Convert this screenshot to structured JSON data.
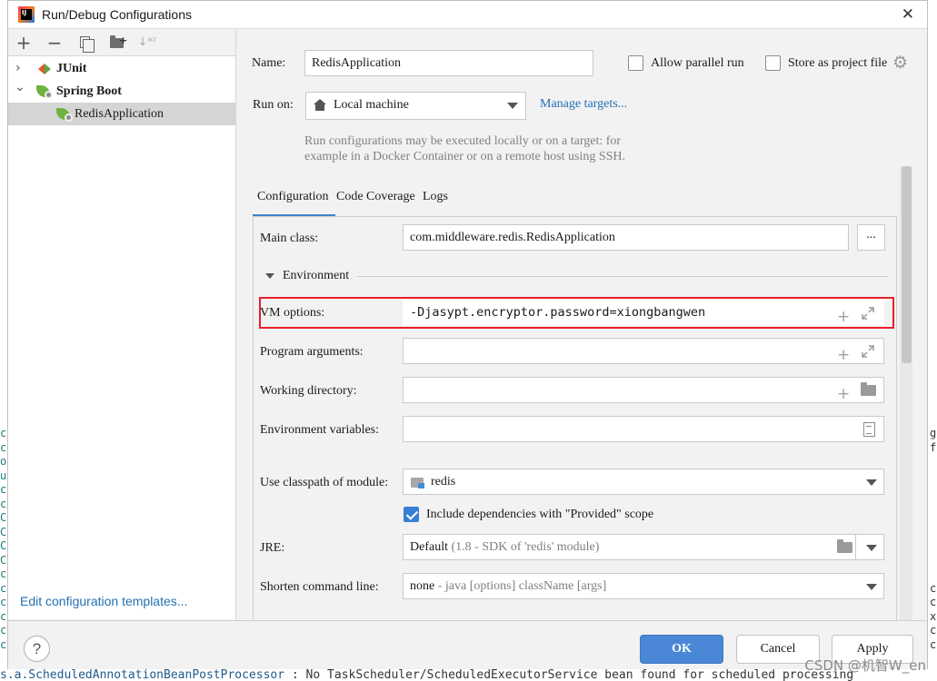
{
  "dialog": {
    "title": "Run/Debug Configurations"
  },
  "toolbar": {
    "add": "+",
    "remove": "−",
    "sort": "↓ᵃᶻ"
  },
  "tree": {
    "items": [
      {
        "label": "JUnit",
        "chevron": "›"
      },
      {
        "label": "Spring Boot",
        "chevron": "⌄"
      },
      {
        "label": "RedisApplication"
      }
    ]
  },
  "left_panel": {
    "edit_templates": "Edit configuration templates..."
  },
  "form": {
    "name_label": "Name:",
    "name_value": "RedisApplication",
    "allow_parallel_label": "Allow parallel run",
    "allow_parallel_checked": false,
    "store_project_label": "Store as project file",
    "store_project_checked": false,
    "run_on_label": "Run on:",
    "run_on_value": "Local machine",
    "manage_targets": "Manage targets...",
    "hint_line1": "Run configurations may be executed locally or on a target: for",
    "hint_line2": "example in a Docker Container or on a remote host using SSH."
  },
  "tabs": [
    {
      "label": "Configuration",
      "active": true
    },
    {
      "label": "Code Coverage",
      "active": false
    },
    {
      "label": "Logs",
      "active": false
    }
  ],
  "config": {
    "main_class_label": "Main class:",
    "main_class_value": "com.middleware.redis.RedisApplication",
    "browse_button": "...",
    "environment_label": "Environment",
    "vm_options_label": "VM options:",
    "vm_options_value": "-Djasypt.encryptor.password=xiongbangwen",
    "program_args_label": "Program arguments:",
    "program_args_value": "",
    "working_dir_label": "Working directory:",
    "working_dir_value": "",
    "env_vars_label": "Environment variables:",
    "env_vars_value": "",
    "classpath_label": "Use classpath of module:",
    "classpath_value": "redis",
    "include_deps_label": "Include dependencies with \"Provided\" scope",
    "include_deps_checked": true,
    "jre_label": "JRE:",
    "jre_value": "Default",
    "jre_detail": "(1.8 - SDK of 'redis' module)",
    "shorten_label": "Shorten command line:",
    "shorten_value": "none",
    "shorten_detail": "- java [options] className [args]"
  },
  "buttons": {
    "help": "?",
    "ok": "OK",
    "cancel": "Cancel",
    "apply": "Apply"
  },
  "background": {
    "left_chars": "c\nc\no\nu\nc\nc\nC\nC\nC\nC\nc\nc\nc\nc\nc\nc",
    "right_chars": "g\nf\n\n\n\n\n\n\n\n\n\nc\nc\nx\nc\nc",
    "bottom_line_left": "s.a.ScheduledAnnotationBeanPostProcessor",
    "bottom_line_right": " : No TaskScheduler/ScheduledExecutorService bean found for scheduled processing",
    "watermark": "CSDN @机智W_en"
  },
  "colors": {
    "accent": "#4a87d6",
    "link": "#2470b3",
    "highlight_border": "#e8202a",
    "selection": "#d5d5d5"
  },
  "icons": {
    "app": "intellij-idea-icon",
    "close": "close-icon",
    "junit": "junit-icon",
    "spring": "spring-boot-icon",
    "settings": "gear-icon",
    "home": "home-icon",
    "module": "module-folder-icon"
  }
}
